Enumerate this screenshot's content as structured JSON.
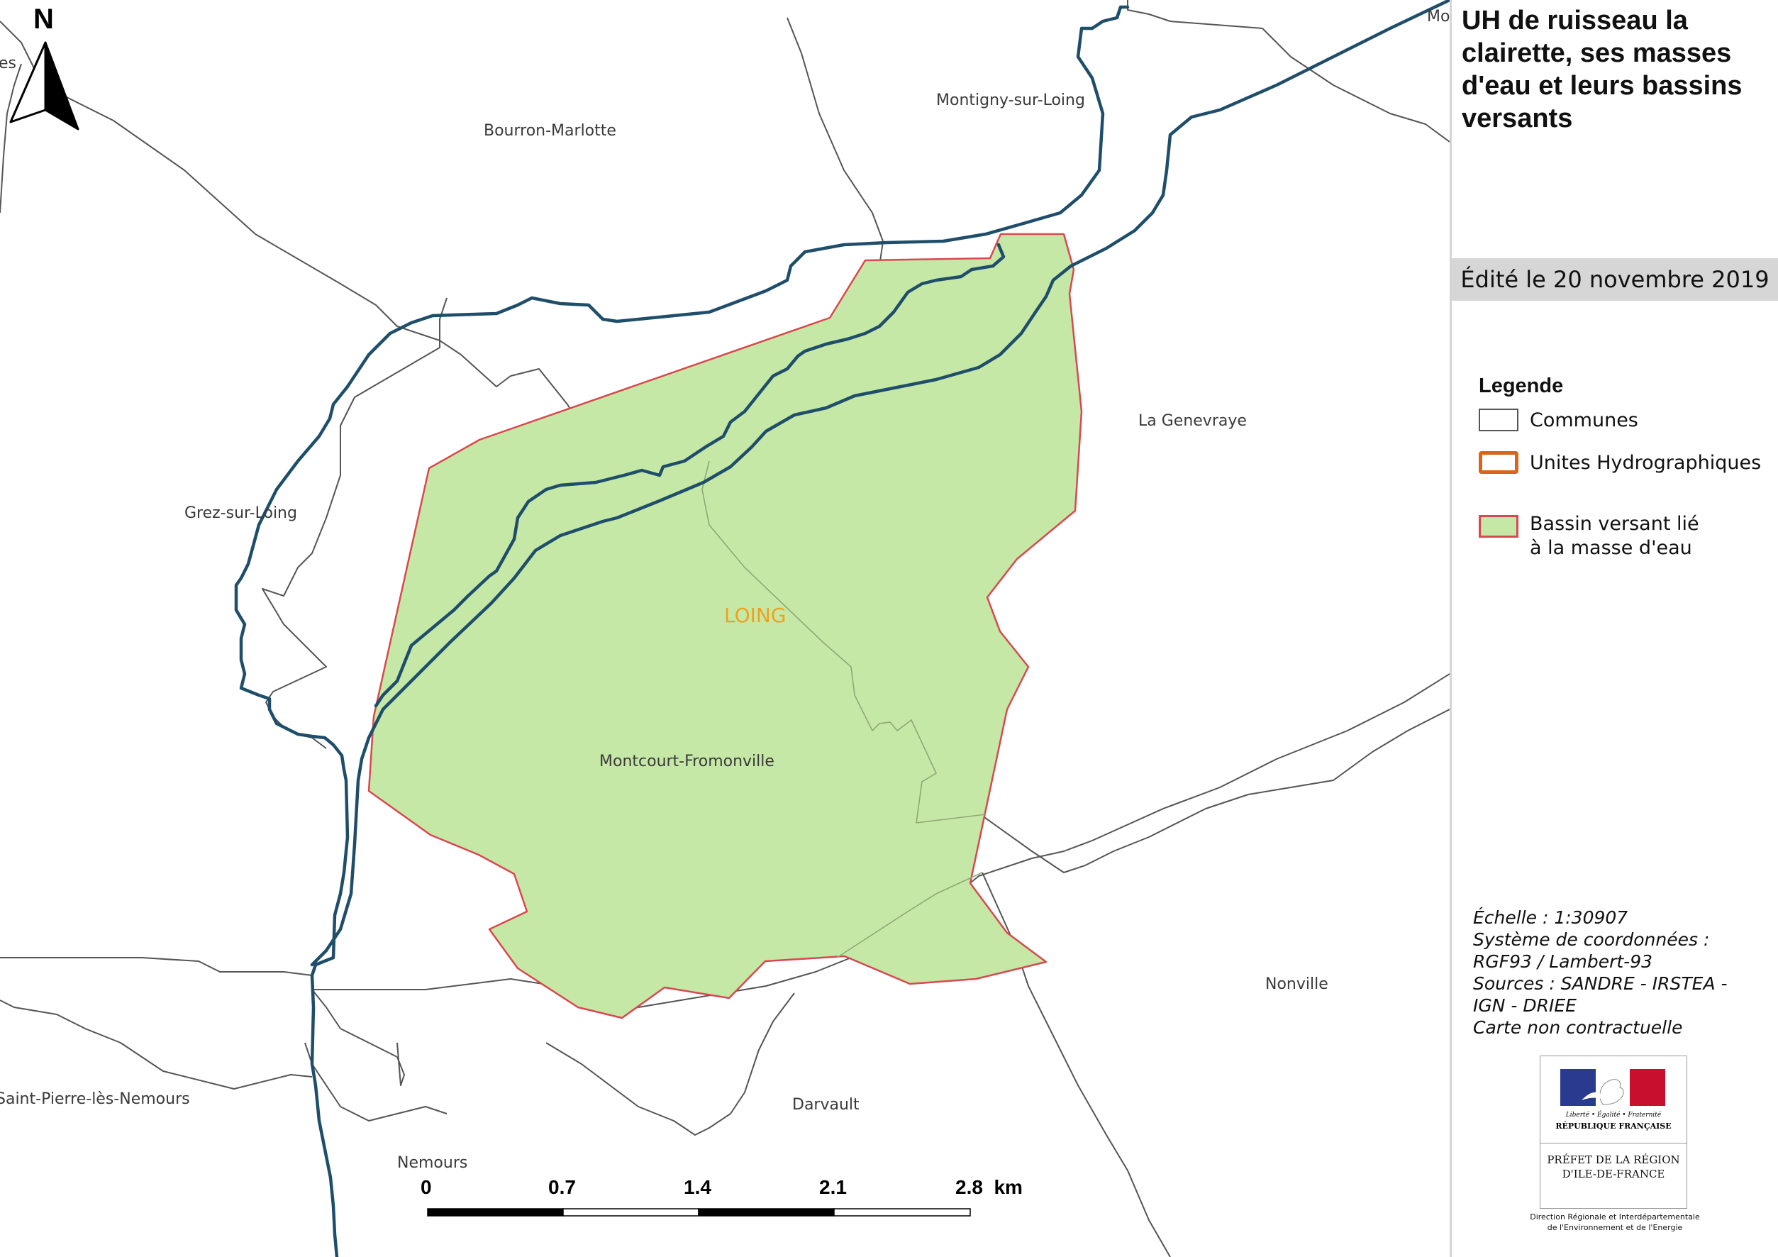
{
  "map": {
    "north_label": "N",
    "uh_label": "LOING",
    "communes": [
      "Bourron-Marlotte",
      "Montigny-sur-Loing",
      "La Genevraye",
      "Grez-sur-Loing",
      "Montcourt-Fromonville",
      "Nonville",
      "Darvault",
      "Saint-Pierre-lès-Nemours",
      "Nemours"
    ],
    "edge_labels": [
      "es",
      "Mo"
    ],
    "scale_ticks": [
      "0",
      "0.7",
      "1.4",
      "2.1",
      "2.8  km"
    ]
  },
  "panel": {
    "title": "UH de ruisseau la clairette, ses masses d'eau et leurs bassins versants",
    "edit_date": "Édité le 20 novembre 2019",
    "legend_title": "Legende",
    "legend_items": [
      {
        "label": "Communes",
        "fill": "#ffffff",
        "stroke": "#555555"
      },
      {
        "label": "Unites Hydrographiques",
        "fill": "#ffffff",
        "stroke": "#d9651b"
      },
      {
        "label": "Bassin versant lié à la masse d'eau",
        "fill": "#c6e8a6",
        "stroke": "#d94850"
      }
    ],
    "info_lines": [
      "Échelle :  1:30907",
      "Système de coordonnées :",
      "RGF93 / Lambert-93",
      "Sources : SANDRE - IRSTEA -",
      "IGN - DRIEE",
      "Carte non contractuelle"
    ],
    "logo": {
      "motto": "Liberté • Égalité • Fraternité",
      "republic": "RÉPUBLIQUE FRANÇAISE",
      "prefet": "PRÉFET DE LA RÉGION D'ILE-DE-FRANCE",
      "driee": "Direction Régionale et Interdépartementale de l'Environnement et de l'Energie"
    }
  },
  "colors": {
    "basin_fill": "#c6e8a6",
    "basin_stroke": "#d94850",
    "river": "#1f4e6b",
    "commune_line": "#555555",
    "uh_label": "#f0a020"
  }
}
